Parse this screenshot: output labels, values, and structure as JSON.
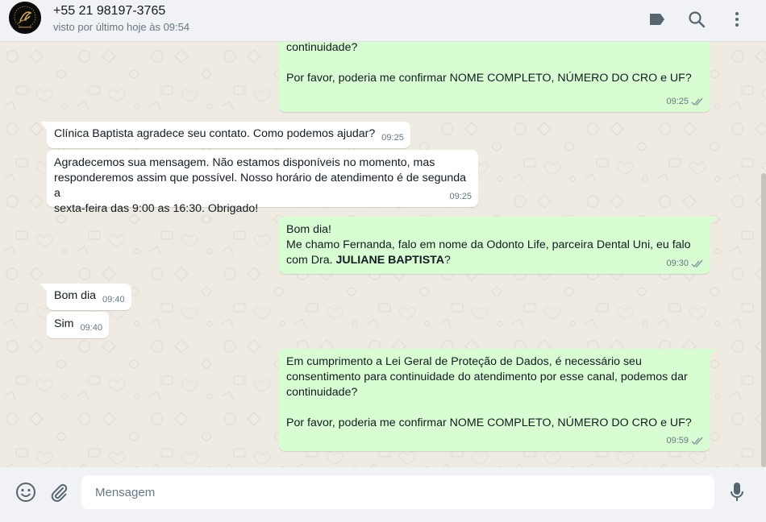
{
  "header": {
    "contact_name": "+55 21 98197-3765",
    "status": "visto por último hoje às 09:54",
    "icons": [
      "label-icon",
      "search-icon",
      "menu-icon"
    ]
  },
  "messages": [
    {
      "direction": "out",
      "lines": [
        "continuidade?",
        "",
        "Por favor, poderia me confirmar NOME COMPLETO, NÚMERO DO CRO e UF?"
      ],
      "time": "09:25",
      "status": "read"
    },
    {
      "direction": "in",
      "text": "Clínica Baptista agradece seu contato. Como podemos ajudar?",
      "time": "09:25"
    },
    {
      "direction": "in",
      "lines": [
        "Agradecemos sua mensagem. Não estamos disponíveis no momento, mas",
        "responderemos assim que possível. Nosso horário de atendimento é de segunda a",
        "sexta-feira das 9:00 as 16:30. Obrigado!"
      ],
      "time": "09:25"
    },
    {
      "direction": "out",
      "line1": "Bom dia!",
      "line2": "Me chamo Fernanda, falo em nome da Odonto Life, parceira Dental Uni, eu falo",
      "line3_prefix": "com Dra. ",
      "line3_bold": "JULIANE BAPTISTA",
      "line3_suffix": "?",
      "time": "09:30",
      "status": "read"
    },
    {
      "direction": "in",
      "text": "Bom dia",
      "time": "09:40"
    },
    {
      "direction": "in",
      "text": "Sim",
      "time": "09:40"
    },
    {
      "direction": "out",
      "lines": [
        "Em cumprimento a Lei Geral de Proteção de Dados, é necessário seu",
        "consentimento para continuidade do atendimento por esse canal, podemos dar",
        "continuidade?",
        "",
        "Por favor, poderia me confirmar NOME COMPLETO, NÚMERO DO CRO e UF?"
      ],
      "time": "09:59",
      "status": "read"
    }
  ],
  "footer": {
    "placeholder": "Mensagem",
    "value": "",
    "icons": [
      "emoji-icon",
      "attach-icon",
      "microphone-icon"
    ]
  },
  "colors": {
    "outgoing_bubble": "#d9fdd3",
    "incoming_bubble": "#ffffff",
    "chat_background": "#efeae2",
    "header_background": "#f0f2f5",
    "read_ticks": "#8696a0"
  }
}
